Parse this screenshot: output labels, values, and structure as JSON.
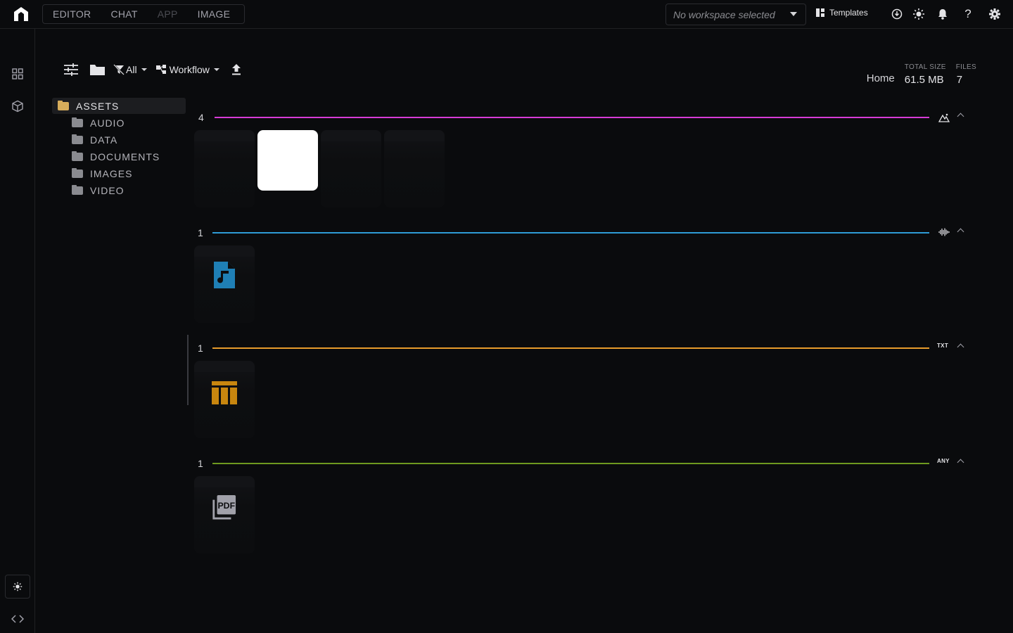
{
  "topbar": {
    "tabs": [
      {
        "label": "EDITOR",
        "disabled": false
      },
      {
        "label": "CHAT",
        "disabled": false
      },
      {
        "label": "APP",
        "disabled": true
      },
      {
        "label": "IMAGE",
        "disabled": false
      }
    ],
    "workspace_placeholder": "No workspace selected",
    "templates_label": "Templates",
    "icons": [
      "upload-status-icon",
      "sun-icon",
      "bell-icon",
      "help-icon",
      "gear-icon"
    ]
  },
  "rail": {
    "icons": [
      "grid-icon",
      "cube-icon",
      "sun-icon",
      "code-icon"
    ]
  },
  "toolbar": {
    "filter_label": "All",
    "group_label": "Workflow"
  },
  "stats": {
    "location": "Home",
    "total_size_label": "TOTAL SIZE",
    "total_size_value": "61.5 MB",
    "files_label": "FILES",
    "files_value": "7"
  },
  "tree": {
    "root": "ASSETS",
    "children": [
      "AUDIO",
      "DATA",
      "DOCUMENTS",
      "IMAGES",
      "VIDEO"
    ],
    "root_folder_color": "#d7ad5b",
    "child_folder_color": "#8a8b90"
  },
  "sections": [
    {
      "count": "4",
      "type_label": "",
      "type_icon": "image-icon",
      "color": "#d63bd6"
    },
    {
      "count": "1",
      "type_label": "",
      "type_icon": "audio-wave-icon",
      "color": "#2e9bd6"
    },
    {
      "count": "1",
      "type_label": "TXT",
      "type_icon": "",
      "color": "#e89c2c"
    },
    {
      "count": "1",
      "type_label": "ANY",
      "type_icon": "",
      "color": "#6e9a1f"
    }
  ],
  "colors": {
    "audio_icon": "#1f7fb5",
    "table_icon": "#c8860f",
    "pdf_icon": "#a1a1aa"
  }
}
